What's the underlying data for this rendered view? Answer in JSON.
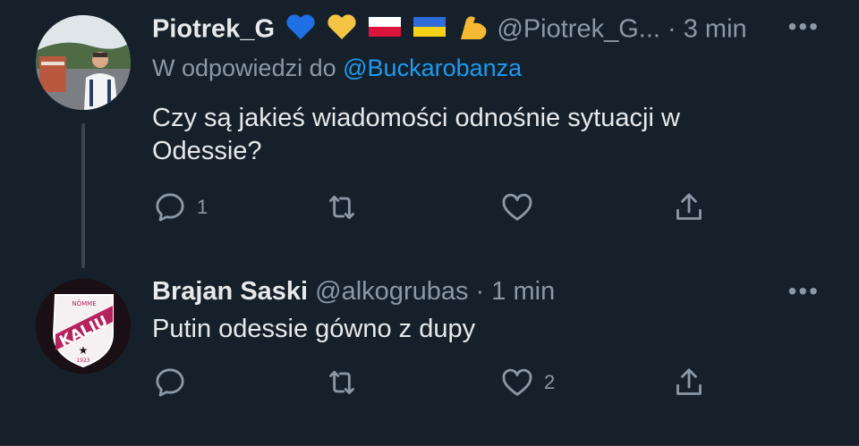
{
  "tweets": [
    {
      "name": "Piotrek_G",
      "badges": [
        "blue-heart",
        "yellow-heart",
        "flag-poland",
        "flag-ukraine",
        "flexed-biceps"
      ],
      "handle": "@Piotrek_G...",
      "separator": "·",
      "time": "3 min",
      "reply_prefix": "W odpowiedzi do",
      "reply_to": "@Buckarobanza",
      "text_line1": "Czy są jakieś wiadomości odnośnie sytuacji w",
      "text_line2": "Odessie?",
      "reply_count": "1",
      "retweet_count": "",
      "like_count": "",
      "more": "•••"
    },
    {
      "name": "Brajan Saski",
      "handle": "@alkogrubas",
      "separator": "·",
      "time": "1 min",
      "text_line1": "Putin odessie gówno z dupy",
      "reply_count": "",
      "retweet_count": "",
      "like_count": "2",
      "more": "•••",
      "avatar_logo": {
        "top": "NÕMME",
        "main": "KALJU",
        "year": "1923"
      }
    }
  ],
  "colors": {
    "background": "#15202b",
    "text": "#e7e9ea",
    "muted": "#8b98a5",
    "link": "#1d9bf0"
  }
}
